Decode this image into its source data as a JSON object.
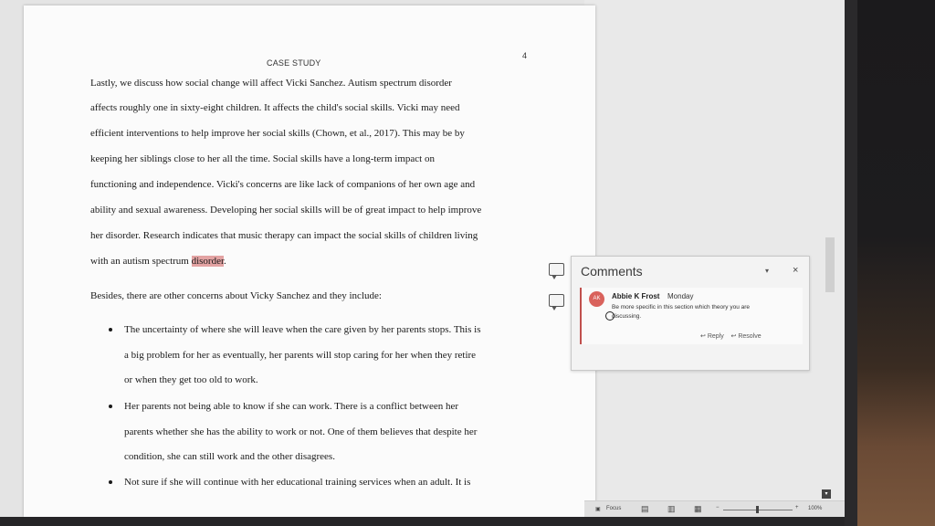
{
  "document": {
    "header_left": "CASE STUDY",
    "page_number": "4",
    "para1": [
      "Lastly, we discuss how social change will affect Vicki Sanchez. Autism spectrum disorder",
      "affects roughly one in sixty-eight children. It affects the child's social skills. Vicki may need",
      "efficient interventions to help improve her social skills (Chown, et al., 2017). This may be by",
      "keeping her siblings close to her all the time. Social skills have a long-term impact on",
      "functioning and independence. Vicki's concerns are like lack of companions of her own age and",
      "ability and sexual awareness. Developing her social skills will be of great impact to help improve",
      "her disorder. Research indicates that music therapy can impact the social skills of children living"
    ],
    "para1_last_prefix": "with an autism spectrum ",
    "para1_last_highlight": "disorder",
    "para1_last_suffix": ".",
    "para2": "Besides, there are other concerns about Vicky Sanchez and they include:",
    "bullets": [
      [
        "The uncertainty of where she will leave when the care given by her parents stops. This is",
        "a big problem for her as eventually, her parents will stop caring for her when they retire",
        "or when they get too old to work."
      ],
      [
        "Her parents not being able to know if she can work. There is a conflict between her",
        "parents whether she has the ability to work or not. One of them believes that despite her",
        "condition, she can still work and the other disagrees."
      ],
      [
        "Not sure if she will continue with her educational training services when an adult. It is"
      ]
    ]
  },
  "comments_pane": {
    "title": "Comments",
    "dropdown": "▾",
    "close": "×",
    "comment": {
      "initials": "AK",
      "author": "Abbie K Frost",
      "date": "Monday",
      "text_line1": "Be more specific in this section which theory you are",
      "text_line2": "discussing.",
      "reply": "Reply",
      "resolve": "Resolve"
    }
  },
  "status_bar": {
    "focus": "Focus",
    "zoom": "100%"
  },
  "icons": [
    "comment-marker-icon",
    "reply-icon",
    "resolve-icon",
    "focus-icon",
    "read-mode-icon",
    "print-layout-icon",
    "web-layout-icon"
  ],
  "colors": {
    "highlight": "#e3a3a3",
    "avatar": "#d9625c",
    "comment_border": "#c0504d"
  }
}
